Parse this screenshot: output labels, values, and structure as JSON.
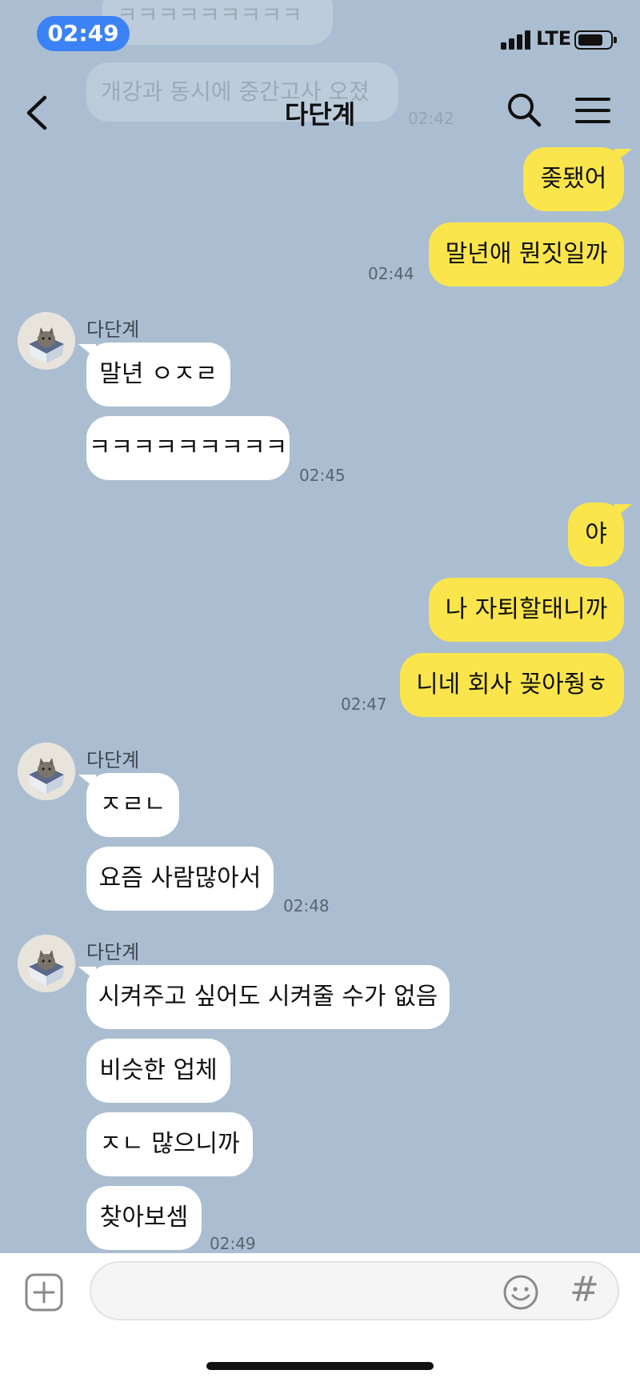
{
  "status_bar": {
    "time": "02:49",
    "network": "LTE"
  },
  "header": {
    "title": "다단계"
  },
  "ghost_messages": [
    {
      "text": "ㅋㅋㅋㅋㅋㅋㅋㅋㅋ"
    },
    {
      "text": "개강과 동시에 중간고사 오졌"
    },
    {
      "time": "02:42"
    }
  ],
  "messages": [
    {
      "from": "me",
      "text": "좆됐어"
    },
    {
      "from": "me",
      "text": "말년애 뭔짓일까",
      "time": "02:44"
    },
    {
      "from": "other",
      "sender": "다단계",
      "text": "말년 ㅇㅈㄹ"
    },
    {
      "from": "other",
      "text": "ㅋㅋㅋㅋㅋㅋㅋㅋㅋ",
      "time": "02:45"
    },
    {
      "from": "me",
      "text": "야"
    },
    {
      "from": "me",
      "text": "나 자퇴할태니까"
    },
    {
      "from": "me",
      "text": "니네 회사 꽂아줭ㅎ",
      "time": "02:47"
    },
    {
      "from": "other",
      "sender": "다단계",
      "text": "ㅈㄹㄴ"
    },
    {
      "from": "other",
      "text": "요즘 사람많아서",
      "time": "02:48"
    },
    {
      "from": "other",
      "sender": "다단계",
      "text": "시켜주고 싶어도 시켜줄 수가 없음"
    },
    {
      "from": "other",
      "text": "비슷한 업체"
    },
    {
      "from": "other",
      "text": "ㅈㄴ 많으니까"
    },
    {
      "from": "other",
      "text": "찾아보셈",
      "time": "02:49"
    }
  ],
  "input_bar": {
    "value": "",
    "placeholder": "",
    "hash_label": "#"
  },
  "icons": {
    "back": "chevron-left-icon",
    "search": "search-icon",
    "menu": "hamburger-menu-icon",
    "attach": "plus-square-icon",
    "emoji": "smiley-icon",
    "avatar": "cat-in-box-avatar"
  },
  "colors": {
    "background": "#abbed1",
    "my_bubble": "#fae54d",
    "their_bubble": "#ffffff",
    "status_time_pill": "#3b82f6"
  }
}
